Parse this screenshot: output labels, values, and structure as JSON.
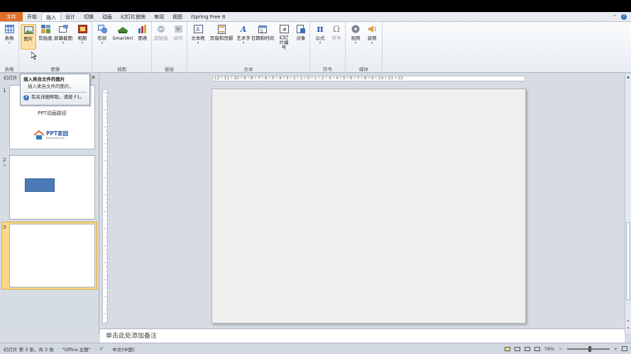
{
  "tabs": [
    "文件",
    "开始",
    "插入",
    "设计",
    "切换",
    "动画",
    "幻灯片放映",
    "审阅",
    "视图",
    "iSpring Free 8"
  ],
  "ribbon": {
    "groups": [
      {
        "label": "表格",
        "buttons": [
          {
            "label": "表格",
            "icon": "table-icon"
          }
        ]
      },
      {
        "label": "图像",
        "buttons": [
          {
            "label": "图片",
            "icon": "picture-icon"
          },
          {
            "label": "剪贴画",
            "icon": "clipart-icon"
          },
          {
            "label": "屏幕截图",
            "icon": "screenshot-icon"
          },
          {
            "label": "相册",
            "icon": "album-icon"
          }
        ]
      },
      {
        "label": "插图",
        "buttons": [
          {
            "label": "形状",
            "icon": "shapes-icon"
          },
          {
            "label": "SmartArt",
            "icon": "smartart-icon"
          },
          {
            "label": "图表",
            "icon": "chart-icon"
          }
        ]
      },
      {
        "label": "链接",
        "buttons": [
          {
            "label": "超链接",
            "icon": "hyperlink-icon"
          },
          {
            "label": "动作",
            "icon": "action-icon"
          }
        ]
      },
      {
        "label": "文本",
        "buttons": [
          {
            "label": "文本框",
            "icon": "textbox-icon"
          },
          {
            "label": "页眉和页脚",
            "icon": "header-footer-icon"
          },
          {
            "label": "艺术字",
            "icon": "wordart-icon"
          },
          {
            "label": "日期和时间",
            "icon": "datetime-icon"
          },
          {
            "label": "幻灯片编号",
            "icon": "slide-number-icon"
          },
          {
            "label": "对象",
            "icon": "object-icon"
          }
        ]
      },
      {
        "label": "符号",
        "buttons": [
          {
            "label": "公式",
            "icon": "equation-icon"
          },
          {
            "label": "符号",
            "icon": "symbol-icon"
          }
        ]
      },
      {
        "label": "媒体",
        "buttons": [
          {
            "label": "视频",
            "icon": "video-icon"
          },
          {
            "label": "音频",
            "icon": "audio-icon"
          }
        ]
      }
    ]
  },
  "tooltip": {
    "title": "插入来自文件的图片",
    "description": "插入来自文件的图片。",
    "help": "有关详细帮助，请按 F1。"
  },
  "panel": {
    "header": "幻灯片",
    "slides": [
      {
        "number": "1",
        "title": "PPT动画路径",
        "logo_text": "PPT家园",
        "logo_sub": "www.pptjy.com"
      },
      {
        "number": "2",
        "star": "☆"
      },
      {
        "number": "3"
      }
    ]
  },
  "ruler_text": "·12·!·11·!·10·!·9·!·8·!·7·!·6·!·5·!·4·!·3·!·2·!·1·!·0·!·1·!·2·!·3·!·4·!·5·!·6·!·7·!·8·!·9·!·10·!·11·!·12·",
  "notes_placeholder": "单击此处添加备注",
  "status": {
    "slide_info": "幻灯片 第 3 张，共 3 张",
    "theme": "\"Office 主题\"",
    "language": "中文(中国)",
    "zoom": "79%"
  },
  "colors": {
    "file_tab": "#e0702a",
    "selected_thumb": "#fbd98a",
    "shape_fill": "#4a7ab8"
  }
}
